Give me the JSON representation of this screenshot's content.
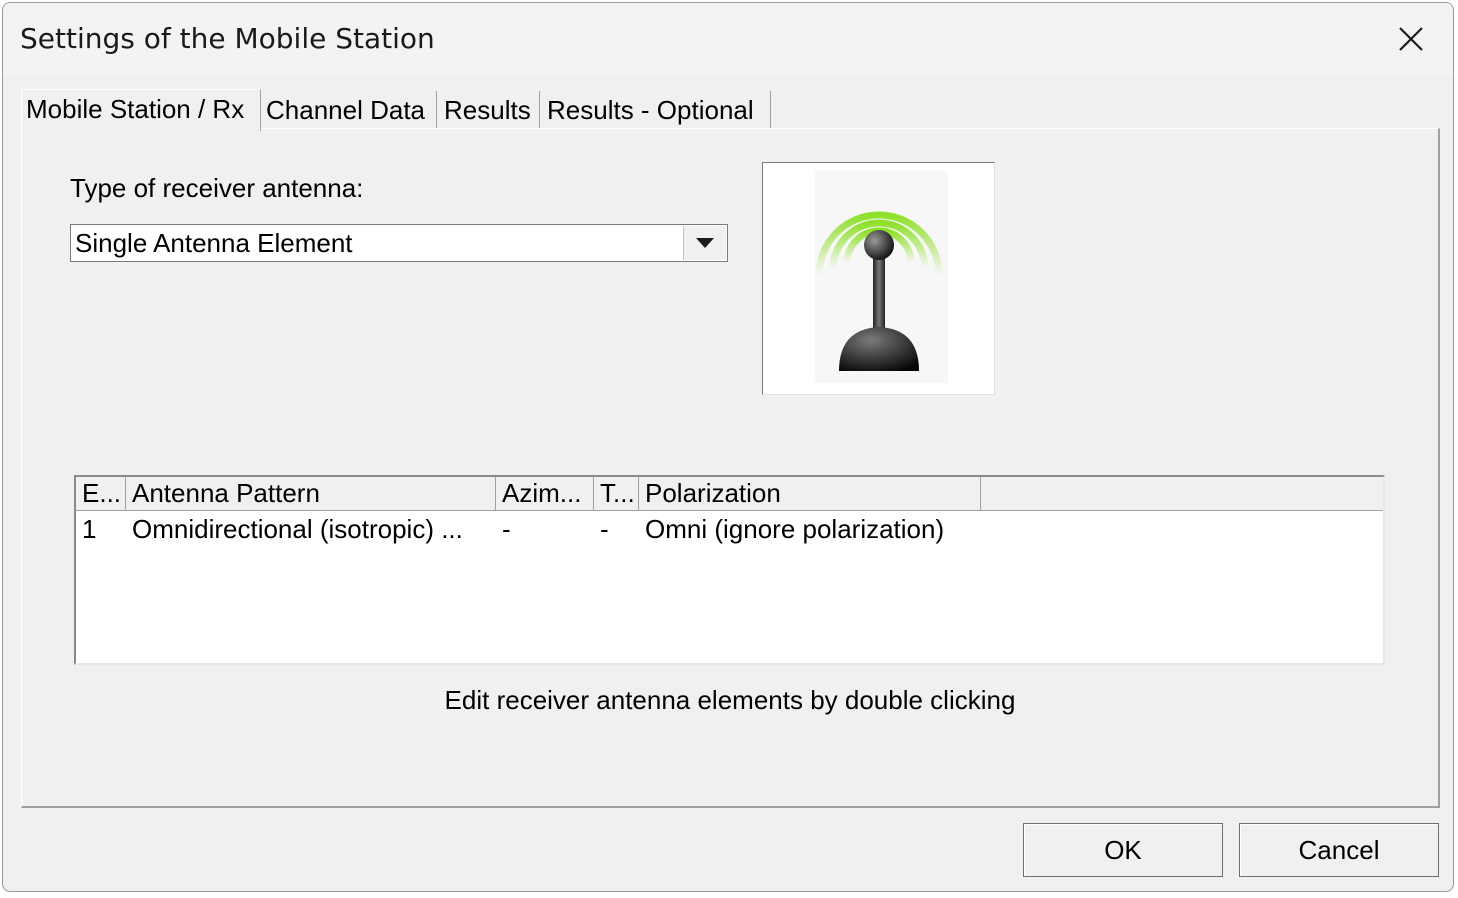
{
  "window": {
    "title": "Settings of the Mobile Station",
    "close_icon": "close-icon"
  },
  "tabs": [
    {
      "label": "Mobile Station / Rx",
      "active": true
    },
    {
      "label": "Channel Data",
      "active": false
    },
    {
      "label": "Results",
      "active": false
    },
    {
      "label": "Results - Optional",
      "active": false
    }
  ],
  "receiver": {
    "type_label": "Type of receiver antenna:",
    "selected_type": "Single Antenna Element",
    "image_icon": "antenna-signal-icon"
  },
  "table": {
    "columns": [
      "E...",
      "Antenna Pattern",
      "Azim...",
      "T...",
      "Polarization"
    ],
    "rows": [
      [
        "1",
        "Omnidirectional (isotropic) ...",
        "-",
        "-",
        "Omni (ignore polarization)"
      ]
    ]
  },
  "hint": "Edit receiver antenna elements by double clicking",
  "buttons": {
    "ok": "OK",
    "cancel": "Cancel"
  },
  "colors": {
    "signal_green": "#8fe02a",
    "antenna_dark": "#1a1a1a"
  }
}
